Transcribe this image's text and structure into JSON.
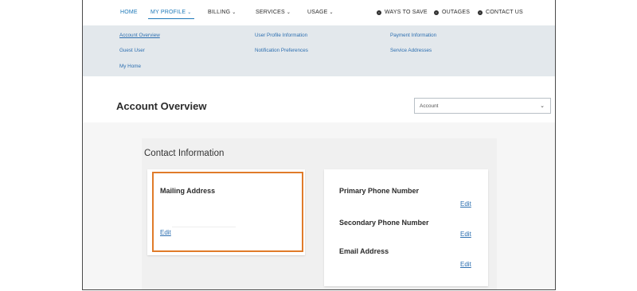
{
  "nav": {
    "home": "HOME",
    "my_profile": "MY PROFILE",
    "billing": "BILLING",
    "services": "SERVICES",
    "usage": "USAGE",
    "ways_to_save": "WAYS TO SAVE",
    "outages": "OUTAGES",
    "contact_us": "CONTACT US"
  },
  "profile_menu": {
    "account_overview": "Account Overview",
    "guest_user": "Guest User",
    "my_home": "My Home",
    "user_profile_information": "User Profile Information",
    "notification_preferences": "Notification Preferences",
    "payment_information": "Payment Information",
    "service_addresses": "Service Addresses"
  },
  "header": {
    "title": "Account Overview",
    "account_select_value": "Account"
  },
  "contact": {
    "section_title": "Contact Information",
    "mailing_address_label": "Mailing Address",
    "mailing_edit": "Edit",
    "primary_phone_label": "Primary Phone Number",
    "primary_phone_edit": "Edit",
    "secondary_phone_label": "Secondary Phone Number",
    "secondary_phone_edit": "Edit",
    "email_label": "Email Address",
    "email_edit": "Edit"
  },
  "colors": {
    "accent": "#1d78b8",
    "link": "#2d6fb0",
    "highlight": "#e07b2a",
    "panel": "#e3e8ec"
  },
  "icons": {
    "chevron": "chevron-down-icon",
    "info": "info-circle-icon"
  }
}
